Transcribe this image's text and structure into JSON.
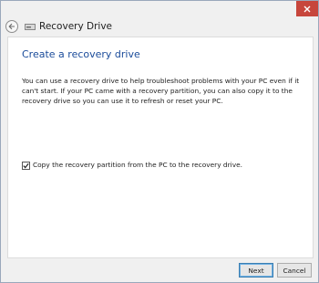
{
  "window": {
    "title": "Recovery Drive",
    "accent_color": "#1a4b9a",
    "close_color": "#c7463c"
  },
  "page": {
    "heading": "Create a recovery drive",
    "description": "You can use a recovery drive to help troubleshoot problems with your PC even if it can't start. If your PC came with a recovery partition, you can also copy it to the recovery drive so you can use it to refresh or reset your PC.",
    "checkbox_label": "Copy the recovery partition from the PC to the recovery drive.",
    "checkbox_checked": true
  },
  "footer": {
    "next_label": "Next",
    "cancel_label": "Cancel"
  },
  "icons": {
    "back": "back-arrow-icon",
    "drive": "drive-icon",
    "close": "close-icon",
    "check": "checkmark-icon"
  }
}
